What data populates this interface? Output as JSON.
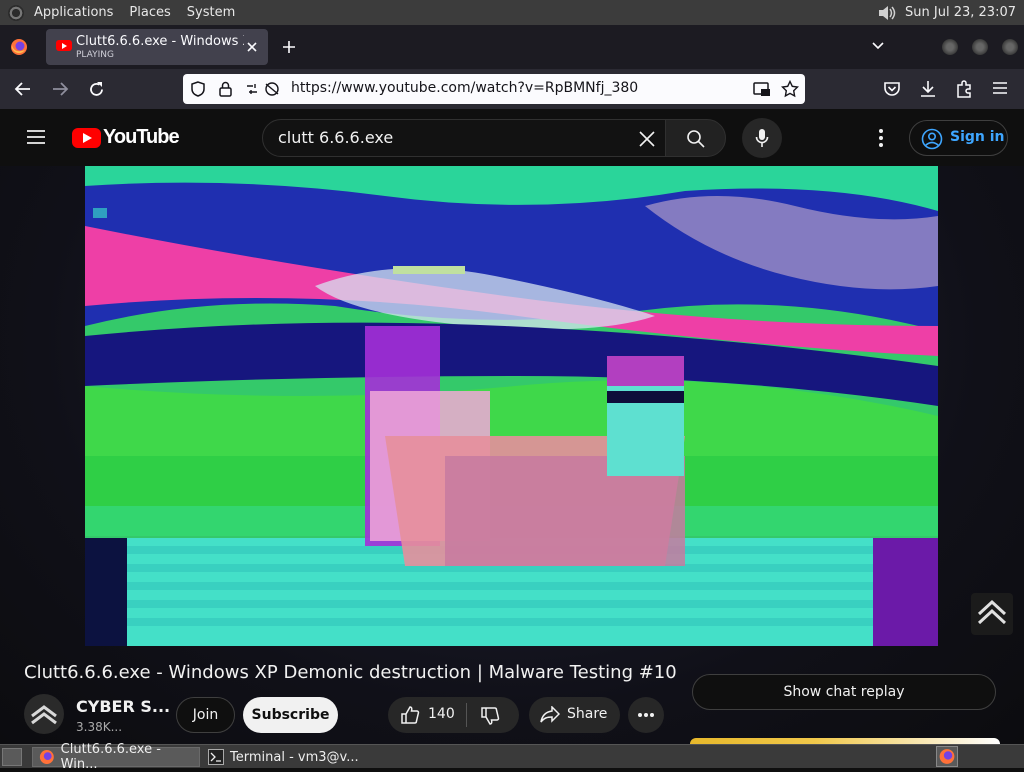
{
  "panel": {
    "menus": [
      "Applications",
      "Places",
      "System"
    ],
    "clock": "Sun Jul 23, 23:07"
  },
  "browser": {
    "tab": {
      "title": "Clutt6.6.6.exe - Windows XP",
      "status": "PLAYING"
    },
    "url": "https://www.youtube.com/watch?v=RpBMNfj_380"
  },
  "youtube": {
    "logo_text": "YouTube",
    "search_value": "clutt 6.6.6.exe",
    "signin_label": "Sign in"
  },
  "video": {
    "title": "Clutt6.6.6.exe - Windows XP Demonic destruction | Malware Testing #10",
    "channel_name": "CYBER S...",
    "subscribers": "3.38K...",
    "join_label": "Join",
    "subscribe_label": "Subscribe",
    "likes": "140",
    "share_label": "Share",
    "chat_replay_label": "Show chat replay"
  },
  "taskbar": {
    "items": [
      "Clutt6.6.6.exe - Win...",
      "Terminal - vm3@v..."
    ]
  },
  "colors": {
    "yt_red": "#ff0000",
    "yt_bg": "#0f0f0f",
    "link_blue": "#3ea6ff",
    "firefox_toolbar": "#2b2a33"
  }
}
